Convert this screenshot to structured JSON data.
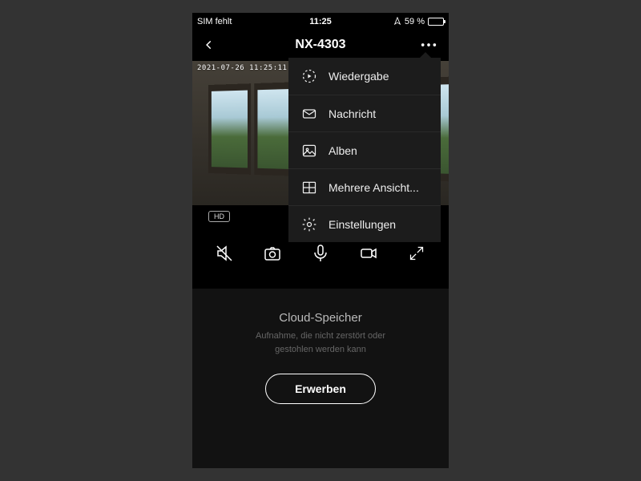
{
  "status": {
    "carrier": "SIM fehlt",
    "time": "11:25",
    "battery_pct": "59 %"
  },
  "nav": {
    "title": "NX-4303"
  },
  "video": {
    "timestamp": "2021-07-26  11:25:11",
    "quality_badge": "HD"
  },
  "menu": {
    "items": [
      {
        "label": "Wiedergabe"
      },
      {
        "label": "Nachricht"
      },
      {
        "label": "Alben"
      },
      {
        "label": "Mehrere Ansicht..."
      },
      {
        "label": "Einstellungen"
      }
    ]
  },
  "cloud": {
    "title": "Cloud-Speicher",
    "subtitle_line1": "Aufnahme, die nicht zerstört oder",
    "subtitle_line2": "gestohlen werden kann",
    "cta": "Erwerben"
  }
}
